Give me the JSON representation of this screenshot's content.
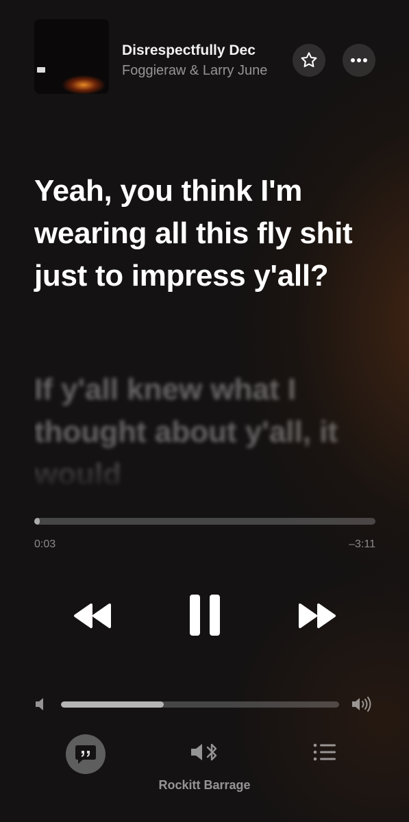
{
  "now_playing": {
    "title": "Disrespectfully Dec",
    "artist": "Foggieraw & Larry June",
    "artwork": "album-artwork"
  },
  "header": {
    "favorite_icon": "star-icon",
    "more_icon": "ellipsis-icon"
  },
  "lyrics": {
    "current": "Yeah, you think I'm wearing all this fly shit just to impress y'all?",
    "next": "If y'all knew what I thought about y'all, it would"
  },
  "playback": {
    "elapsed": "0:03",
    "remaining": "–3:11",
    "progress_fraction": 0.016
  },
  "controls": {
    "rewind_icon": "rewind-icon",
    "pause_icon": "pause-icon",
    "forward_icon": "fast-forward-icon"
  },
  "volume": {
    "level_fraction": 0.37,
    "low_icon": "speaker-low-icon",
    "high_icon": "speaker-high-icon"
  },
  "bottom_bar": {
    "lyrics_icon": "lyrics-quote-icon",
    "output_icon": "bluetooth-speaker-icon",
    "queue_icon": "queue-list-icon",
    "device_name": "Rockitt Barrage"
  },
  "colors": {
    "background": "#141212",
    "accent_glow": "#7a3c14",
    "text_primary": "#ffffff"
  }
}
